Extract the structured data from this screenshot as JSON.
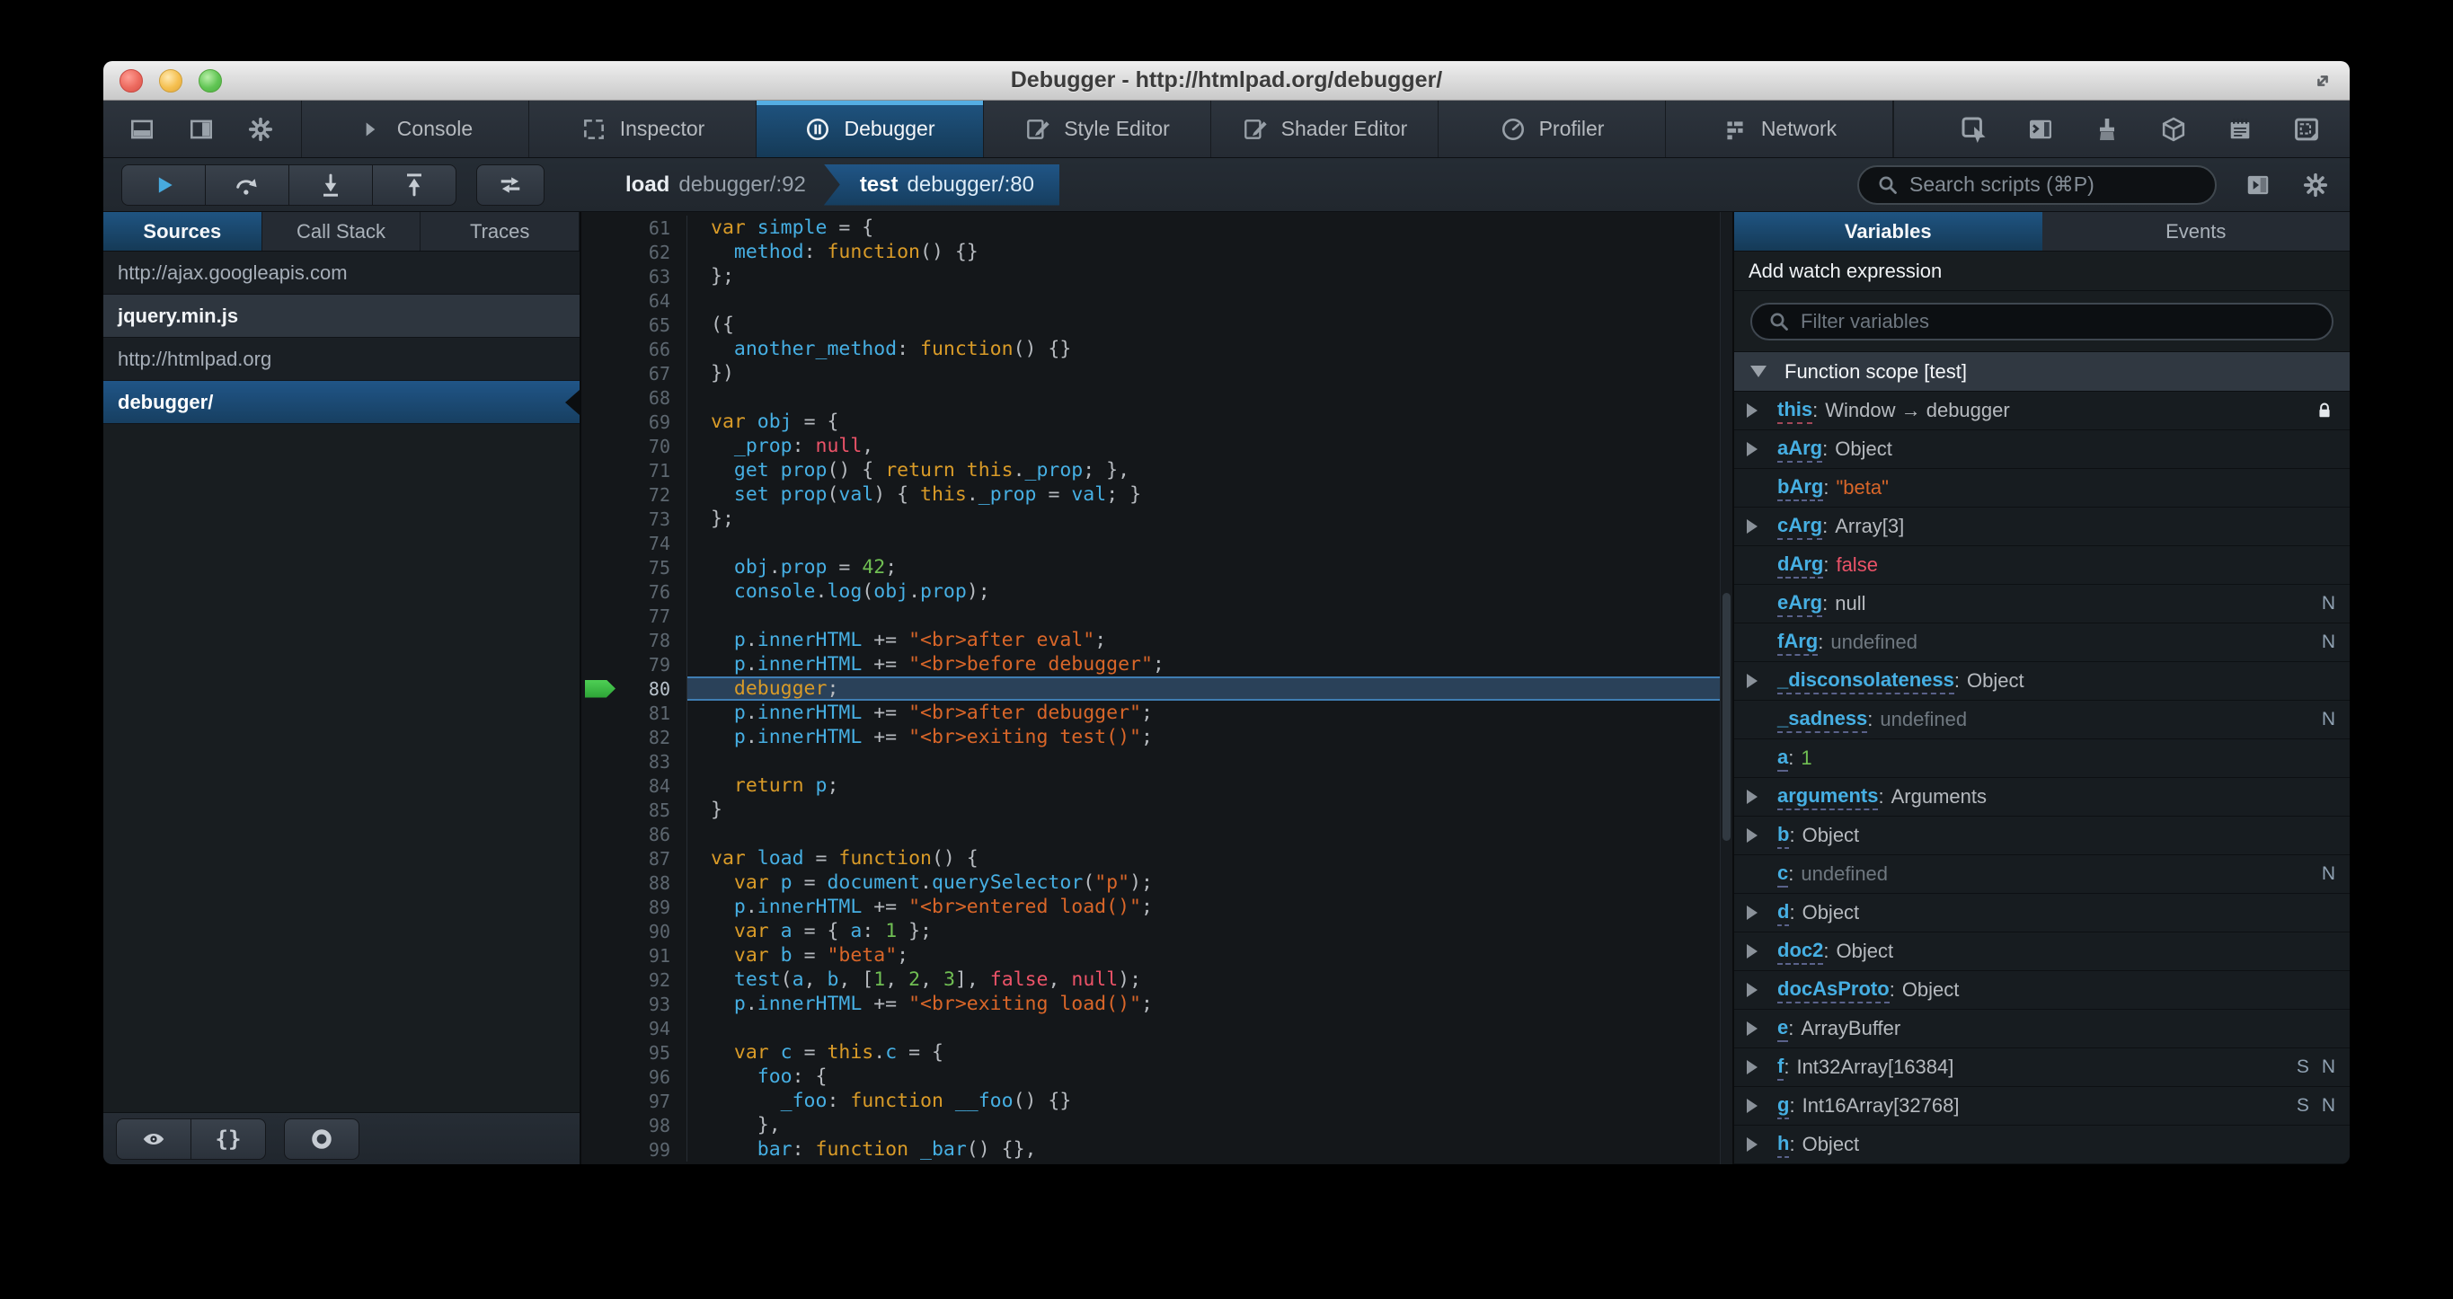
{
  "window": {
    "title": "Debugger - http://htmlpad.org/debugger/"
  },
  "colors": {
    "accent_blue": "#46afe3",
    "selection_blue": "#1d4f73",
    "toolbar_bg": "#252c33",
    "editor_bg": "#14171a",
    "string_orange": "#d96629",
    "keyword_tan": "#d99b28",
    "number_green": "#70bf53",
    "error_red": "#eb5368",
    "current_line_bg": "#2a4159",
    "paused_arrow_green": "#38bd45"
  },
  "tabbar": {
    "left_icons": [
      "dock-bottom",
      "dock-side",
      "settings-gear"
    ],
    "tabs": [
      {
        "label": "Console",
        "icon": "console"
      },
      {
        "label": "Inspector",
        "icon": "inspector"
      },
      {
        "label": "Debugger",
        "icon": "debugger",
        "active": true
      },
      {
        "label": "Style Editor",
        "icon": "style-editor"
      },
      {
        "label": "Shader Editor",
        "icon": "shader-editor"
      },
      {
        "label": "Profiler",
        "icon": "profiler"
      },
      {
        "label": "Network",
        "icon": "network"
      }
    ],
    "right_icons": [
      "pick-element",
      "split-console",
      "paintbrush",
      "tilt-3d",
      "scratchpad",
      "responsive-mode"
    ]
  },
  "toolbar": {
    "buttons": [
      {
        "name": "resume"
      },
      {
        "name": "step-over"
      },
      {
        "name": "step-in"
      },
      {
        "name": "step-out"
      }
    ],
    "toggle_button": {
      "name": "toggle-panes"
    },
    "breadcrumb": [
      {
        "fn": "load",
        "loc": "debugger/:92"
      },
      {
        "fn": "test",
        "loc": "debugger/:80",
        "active": true
      }
    ],
    "search_placeholder": "Search scripts (⌘P)"
  },
  "sidebar": {
    "tabs": [
      {
        "label": "Sources",
        "active": true
      },
      {
        "label": "Call Stack"
      },
      {
        "label": "Traces"
      }
    ],
    "sources": [
      {
        "label": "http://ajax.googleapis.com",
        "kind": "group"
      },
      {
        "label": "jquery.min.js",
        "kind": "file"
      },
      {
        "label": "http://htmlpad.org",
        "kind": "group"
      },
      {
        "label": "debugger/",
        "kind": "file",
        "selected": true
      }
    ],
    "footer_buttons": [
      {
        "name": "blackbox-sources",
        "icon": "eye"
      },
      {
        "name": "pretty-print",
        "glyph": "{}"
      },
      {
        "name": "pause-on-exceptions",
        "icon": "ring"
      }
    ]
  },
  "editor": {
    "lines": [
      {
        "n": 61,
        "t": [
          [
            "k",
            "var "
          ],
          [
            "i",
            "simple"
          ],
          [
            "d",
            " = {"
          ]
        ]
      },
      {
        "n": 62,
        "t": [
          [
            "d",
            "  "
          ],
          [
            "i",
            "method"
          ],
          [
            "d",
            ": "
          ],
          [
            "k",
            "function"
          ],
          [
            "d",
            "() {}"
          ]
        ]
      },
      {
        "n": 63,
        "t": [
          [
            "d",
            "};"
          ]
        ]
      },
      {
        "n": 64,
        "t": []
      },
      {
        "n": 65,
        "t": [
          [
            "d",
            "({"
          ]
        ]
      },
      {
        "n": 66,
        "t": [
          [
            "d",
            "  "
          ],
          [
            "i",
            "another_method"
          ],
          [
            "d",
            ": "
          ],
          [
            "k",
            "function"
          ],
          [
            "d",
            "() {}"
          ]
        ]
      },
      {
        "n": 67,
        "t": [
          [
            "d",
            "})"
          ]
        ]
      },
      {
        "n": 68,
        "t": []
      },
      {
        "n": 69,
        "t": [
          [
            "k",
            "var "
          ],
          [
            "i",
            "obj"
          ],
          [
            "d",
            " = {"
          ]
        ]
      },
      {
        "n": 70,
        "t": [
          [
            "d",
            "  "
          ],
          [
            "i",
            "_prop"
          ],
          [
            "d",
            ": "
          ],
          [
            "r",
            "null"
          ],
          [
            "d",
            ","
          ]
        ]
      },
      {
        "n": 71,
        "t": [
          [
            "d",
            "  "
          ],
          [
            "i",
            "get prop"
          ],
          [
            "d",
            "() { "
          ],
          [
            "k",
            "return "
          ],
          [
            "k",
            "this"
          ],
          [
            "d",
            "."
          ],
          [
            "i",
            "_prop"
          ],
          [
            "d",
            "; },"
          ]
        ]
      },
      {
        "n": 72,
        "t": [
          [
            "d",
            "  "
          ],
          [
            "i",
            "set prop"
          ],
          [
            "d",
            "("
          ],
          [
            "i",
            "val"
          ],
          [
            "d",
            ") { "
          ],
          [
            "k",
            "this"
          ],
          [
            "d",
            "."
          ],
          [
            "i",
            "_prop"
          ],
          [
            "d",
            " = "
          ],
          [
            "i",
            "val"
          ],
          [
            "d",
            "; }"
          ]
        ]
      },
      {
        "n": 73,
        "t": [
          [
            "d",
            "};"
          ]
        ]
      },
      {
        "n": 74,
        "t": []
      },
      {
        "n": 75,
        "t": [
          [
            "d",
            "  "
          ],
          [
            "i",
            "obj"
          ],
          [
            "d",
            "."
          ],
          [
            "i",
            "prop"
          ],
          [
            "d",
            " = "
          ],
          [
            "n",
            "42"
          ],
          [
            "d",
            ";"
          ]
        ]
      },
      {
        "n": 76,
        "t": [
          [
            "d",
            "  "
          ],
          [
            "i",
            "console"
          ],
          [
            "d",
            "."
          ],
          [
            "i",
            "log"
          ],
          [
            "d",
            "("
          ],
          [
            "i",
            "obj"
          ],
          [
            "d",
            "."
          ],
          [
            "i",
            "prop"
          ],
          [
            "d",
            ");"
          ]
        ]
      },
      {
        "n": 77,
        "t": []
      },
      {
        "n": 78,
        "t": [
          [
            "d",
            "  "
          ],
          [
            "i",
            "p"
          ],
          [
            "d",
            "."
          ],
          [
            "i",
            "innerHTML"
          ],
          [
            "d",
            " += "
          ],
          [
            "s",
            "\"<br>after eval\""
          ],
          [
            "d",
            ";"
          ]
        ]
      },
      {
        "n": 79,
        "t": [
          [
            "d",
            "  "
          ],
          [
            "i",
            "p"
          ],
          [
            "d",
            "."
          ],
          [
            "i",
            "innerHTML"
          ],
          [
            "d",
            " += "
          ],
          [
            "s",
            "\"<br>before debugger\""
          ],
          [
            "d",
            ";"
          ]
        ]
      },
      {
        "n": 80,
        "current": true,
        "t": [
          [
            "d",
            "  "
          ],
          [
            "k",
            "debugger"
          ],
          [
            "d",
            ";"
          ]
        ]
      },
      {
        "n": 81,
        "t": [
          [
            "d",
            "  "
          ],
          [
            "i",
            "p"
          ],
          [
            "d",
            "."
          ],
          [
            "i",
            "innerHTML"
          ],
          [
            "d",
            " += "
          ],
          [
            "s",
            "\"<br>after debugger\""
          ],
          [
            "d",
            ";"
          ]
        ]
      },
      {
        "n": 82,
        "t": [
          [
            "d",
            "  "
          ],
          [
            "i",
            "p"
          ],
          [
            "d",
            "."
          ],
          [
            "i",
            "innerHTML"
          ],
          [
            "d",
            " += "
          ],
          [
            "s",
            "\"<br>exiting test()\""
          ],
          [
            "d",
            ";"
          ]
        ]
      },
      {
        "n": 83,
        "t": []
      },
      {
        "n": 84,
        "t": [
          [
            "d",
            "  "
          ],
          [
            "k",
            "return "
          ],
          [
            "i",
            "p"
          ],
          [
            "d",
            ";"
          ]
        ]
      },
      {
        "n": 85,
        "t": [
          [
            "d",
            "}"
          ]
        ]
      },
      {
        "n": 86,
        "t": []
      },
      {
        "n": 87,
        "t": [
          [
            "k",
            "var "
          ],
          [
            "i",
            "load"
          ],
          [
            "d",
            " = "
          ],
          [
            "k",
            "function"
          ],
          [
            "d",
            "() {"
          ]
        ]
      },
      {
        "n": 88,
        "t": [
          [
            "d",
            "  "
          ],
          [
            "k",
            "var "
          ],
          [
            "i",
            "p"
          ],
          [
            "d",
            " = "
          ],
          [
            "i",
            "document"
          ],
          [
            "d",
            "."
          ],
          [
            "i",
            "querySelector"
          ],
          [
            "d",
            "("
          ],
          [
            "s",
            "\"p\""
          ],
          [
            "d",
            ");"
          ]
        ]
      },
      {
        "n": 89,
        "t": [
          [
            "d",
            "  "
          ],
          [
            "i",
            "p"
          ],
          [
            "d",
            "."
          ],
          [
            "i",
            "innerHTML"
          ],
          [
            "d",
            " += "
          ],
          [
            "s",
            "\"<br>entered load()\""
          ],
          [
            "d",
            ";"
          ]
        ]
      },
      {
        "n": 90,
        "t": [
          [
            "d",
            "  "
          ],
          [
            "k",
            "var "
          ],
          [
            "i",
            "a"
          ],
          [
            "d",
            " = { "
          ],
          [
            "i",
            "a"
          ],
          [
            "d",
            ": "
          ],
          [
            "n",
            "1"
          ],
          [
            "d",
            " };"
          ]
        ]
      },
      {
        "n": 91,
        "t": [
          [
            "d",
            "  "
          ],
          [
            "k",
            "var "
          ],
          [
            "i",
            "b"
          ],
          [
            "d",
            " = "
          ],
          [
            "s",
            "\"beta\""
          ],
          [
            "d",
            ";"
          ]
        ]
      },
      {
        "n": 92,
        "t": [
          [
            "d",
            "  "
          ],
          [
            "i",
            "test"
          ],
          [
            "d",
            "("
          ],
          [
            "i",
            "a"
          ],
          [
            "d",
            ", "
          ],
          [
            "i",
            "b"
          ],
          [
            "d",
            ", ["
          ],
          [
            "n",
            "1"
          ],
          [
            "d",
            ", "
          ],
          [
            "n",
            "2"
          ],
          [
            "d",
            ", "
          ],
          [
            "n",
            "3"
          ],
          [
            "d",
            "], "
          ],
          [
            "r",
            "false"
          ],
          [
            "d",
            ", "
          ],
          [
            "r",
            "null"
          ],
          [
            "d",
            ");"
          ]
        ]
      },
      {
        "n": 93,
        "t": [
          [
            "d",
            "  "
          ],
          [
            "i",
            "p"
          ],
          [
            "d",
            "."
          ],
          [
            "i",
            "innerHTML"
          ],
          [
            "d",
            " += "
          ],
          [
            "s",
            "\"<br>exiting load()\""
          ],
          [
            "d",
            ";"
          ]
        ]
      },
      {
        "n": 94,
        "t": []
      },
      {
        "n": 95,
        "t": [
          [
            "d",
            "  "
          ],
          [
            "k",
            "var "
          ],
          [
            "i",
            "c"
          ],
          [
            "d",
            " = "
          ],
          [
            "k",
            "this"
          ],
          [
            "d",
            "."
          ],
          [
            "i",
            "c"
          ],
          [
            "d",
            " = {"
          ]
        ]
      },
      {
        "n": 96,
        "t": [
          [
            "d",
            "    "
          ],
          [
            "i",
            "foo"
          ],
          [
            "d",
            ": {"
          ]
        ]
      },
      {
        "n": 97,
        "t": [
          [
            "d",
            "      "
          ],
          [
            "i",
            "_foo"
          ],
          [
            "d",
            ": "
          ],
          [
            "k",
            "function "
          ],
          [
            "i",
            "__foo"
          ],
          [
            "d",
            "() {}"
          ]
        ]
      },
      {
        "n": 98,
        "t": [
          [
            "d",
            "    },"
          ]
        ]
      },
      {
        "n": 99,
        "t": [
          [
            "d",
            "    "
          ],
          [
            "i",
            "bar"
          ],
          [
            "d",
            ": "
          ],
          [
            "k",
            "function "
          ],
          [
            "i",
            "_bar"
          ],
          [
            "d",
            "() {},"
          ]
        ]
      }
    ]
  },
  "variables_panel": {
    "tabs": [
      {
        "label": "Variables",
        "active": true
      },
      {
        "label": "Events"
      }
    ],
    "watch_label": "Add watch expression",
    "filter_placeholder": "Filter variables",
    "scope_label": "Function scope [test]",
    "variables": [
      {
        "name": "this",
        "value": "Window → debugger",
        "vclass": "obj",
        "expand": true,
        "lock": true,
        "underline": "red"
      },
      {
        "name": "aArg",
        "value": "Object",
        "vclass": "obj",
        "expand": true
      },
      {
        "name": "bArg",
        "value": "\"beta\"",
        "vclass": "str"
      },
      {
        "name": "cArg",
        "value": "Array[3]",
        "vclass": "obj",
        "expand": true
      },
      {
        "name": "dArg",
        "value": "false",
        "vclass": "bool"
      },
      {
        "name": "eArg",
        "value": "null",
        "vclass": "null",
        "badges": [
          "N"
        ]
      },
      {
        "name": "fArg",
        "value": "undefined",
        "vclass": "undef",
        "badges": [
          "N"
        ]
      },
      {
        "name": "_disconsolateness",
        "value": "Object",
        "vclass": "obj",
        "expand": true
      },
      {
        "name": "_sadness",
        "value": "undefined",
        "vclass": "undef",
        "badges": [
          "N"
        ]
      },
      {
        "name": "a",
        "value": "1",
        "vclass": "num"
      },
      {
        "name": "arguments",
        "value": "Arguments",
        "vclass": "obj",
        "expand": true
      },
      {
        "name": "b",
        "value": "Object",
        "vclass": "obj",
        "expand": true
      },
      {
        "name": "c",
        "value": "undefined",
        "vclass": "undef",
        "badges": [
          "N"
        ]
      },
      {
        "name": "d",
        "value": "Object",
        "vclass": "obj",
        "expand": true
      },
      {
        "name": "doc2",
        "value": "Object",
        "vclass": "obj",
        "expand": true
      },
      {
        "name": "docAsProto",
        "value": "Object",
        "vclass": "obj",
        "expand": true
      },
      {
        "name": "e",
        "value": "ArrayBuffer",
        "vclass": "obj",
        "expand": true
      },
      {
        "name": "f",
        "value": "Int32Array[16384]",
        "vclass": "obj",
        "expand": true,
        "badges": [
          "S",
          "N"
        ]
      },
      {
        "name": "g",
        "value": "Int16Array[32768]",
        "vclass": "obj",
        "expand": true,
        "badges": [
          "S",
          "N"
        ]
      },
      {
        "name": "h",
        "value": "Object",
        "vclass": "obj",
        "expand": true
      }
    ]
  }
}
